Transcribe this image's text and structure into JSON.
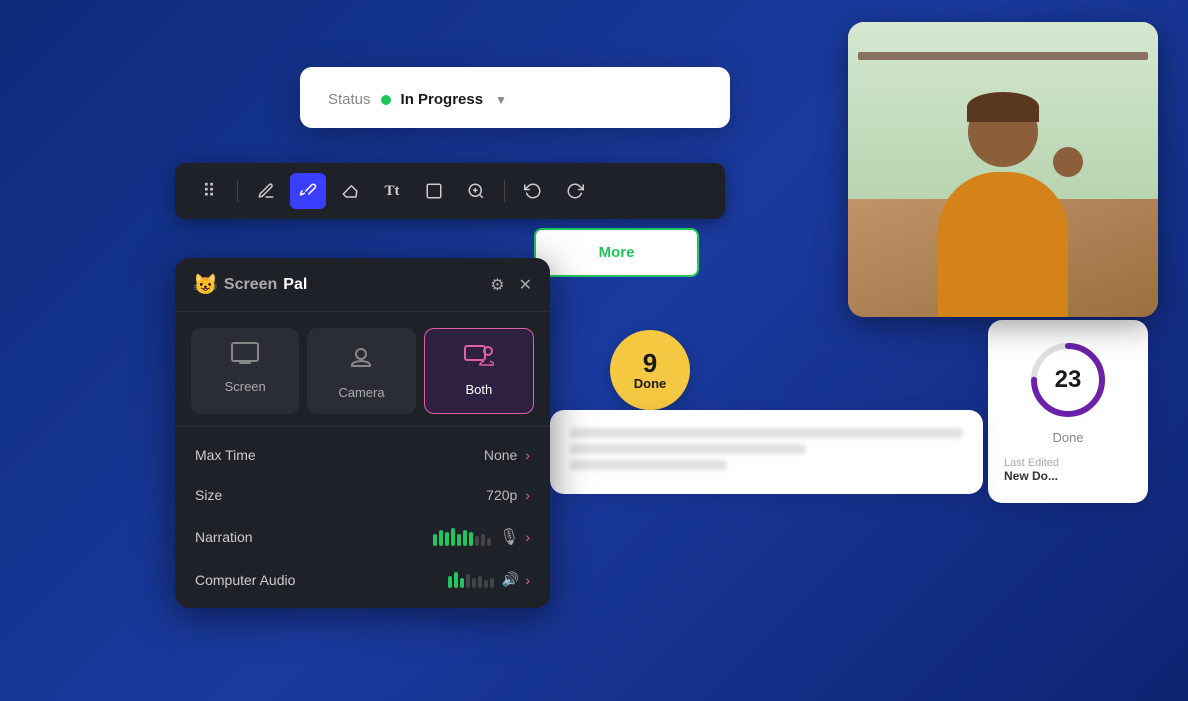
{
  "background": {
    "color": "#1a3a8f"
  },
  "status_card": {
    "label": "Status",
    "dot_color": "#22c55e",
    "value": "In Progress",
    "chevron": "▼"
  },
  "toolbar": {
    "icons": [
      {
        "name": "grip-icon",
        "symbol": "⠿",
        "active": false
      },
      {
        "name": "pen-icon",
        "symbol": "✏",
        "active": false
      },
      {
        "name": "brush-icon",
        "symbol": "🖌",
        "active": true
      },
      {
        "name": "eraser-icon",
        "symbol": "◻",
        "active": false
      },
      {
        "name": "text-icon",
        "symbol": "Tt",
        "active": false
      },
      {
        "name": "rectangle-icon",
        "symbol": "□",
        "active": false
      },
      {
        "name": "zoom-icon",
        "symbol": "⊕",
        "active": false
      },
      {
        "name": "undo-icon",
        "symbol": "↩",
        "active": false
      },
      {
        "name": "redo-icon",
        "symbol": "↪",
        "active": false
      }
    ]
  },
  "more_button": {
    "label": "More"
  },
  "screenpal": {
    "logo_screen": "Screen",
    "logo_pal": "Pal",
    "gear_label": "⚙",
    "close_label": "✕",
    "modes": [
      {
        "id": "screen",
        "label": "Screen",
        "active": false
      },
      {
        "id": "camera",
        "label": "Camera",
        "active": false
      },
      {
        "id": "both",
        "label": "Both",
        "active": true
      }
    ],
    "settings": [
      {
        "label": "Max Time",
        "value": "None"
      },
      {
        "label": "Size",
        "value": "720p"
      },
      {
        "label": "Narration",
        "value": "",
        "has_bars": true,
        "has_mic": true
      },
      {
        "label": "Computer Audio",
        "value": "",
        "has_bars": true,
        "has_speaker": true
      }
    ]
  },
  "kanban": {
    "done_number": "9",
    "done_label": "Done",
    "ring_number": "23",
    "ring_done": "Done",
    "last_edited": "Last Edited",
    "project_name": "New Do..."
  }
}
